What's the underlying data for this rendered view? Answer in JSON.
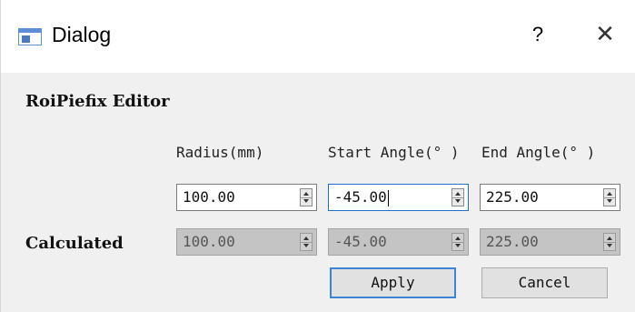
{
  "window": {
    "title": "Dialog",
    "help_glyph": "?",
    "close_glyph": "✕"
  },
  "editor": {
    "group_title": "RoiPiefix Editor",
    "columns": [
      "Radius(mm)",
      "Start Angle(° )",
      "End Angle(° )"
    ],
    "input_row": {
      "radius": "100.00",
      "start_angle": "-45.00",
      "end_angle": "225.00"
    },
    "calculated_row": {
      "label": "Calculated",
      "radius": "100.00",
      "start_angle": "-45.00",
      "end_angle": "225.00"
    }
  },
  "buttons": {
    "apply": "Apply",
    "cancel": "Cancel"
  },
  "icons": {
    "window": "dialog-window-icon",
    "spin_arrows": "spin-up-down-icon"
  }
}
